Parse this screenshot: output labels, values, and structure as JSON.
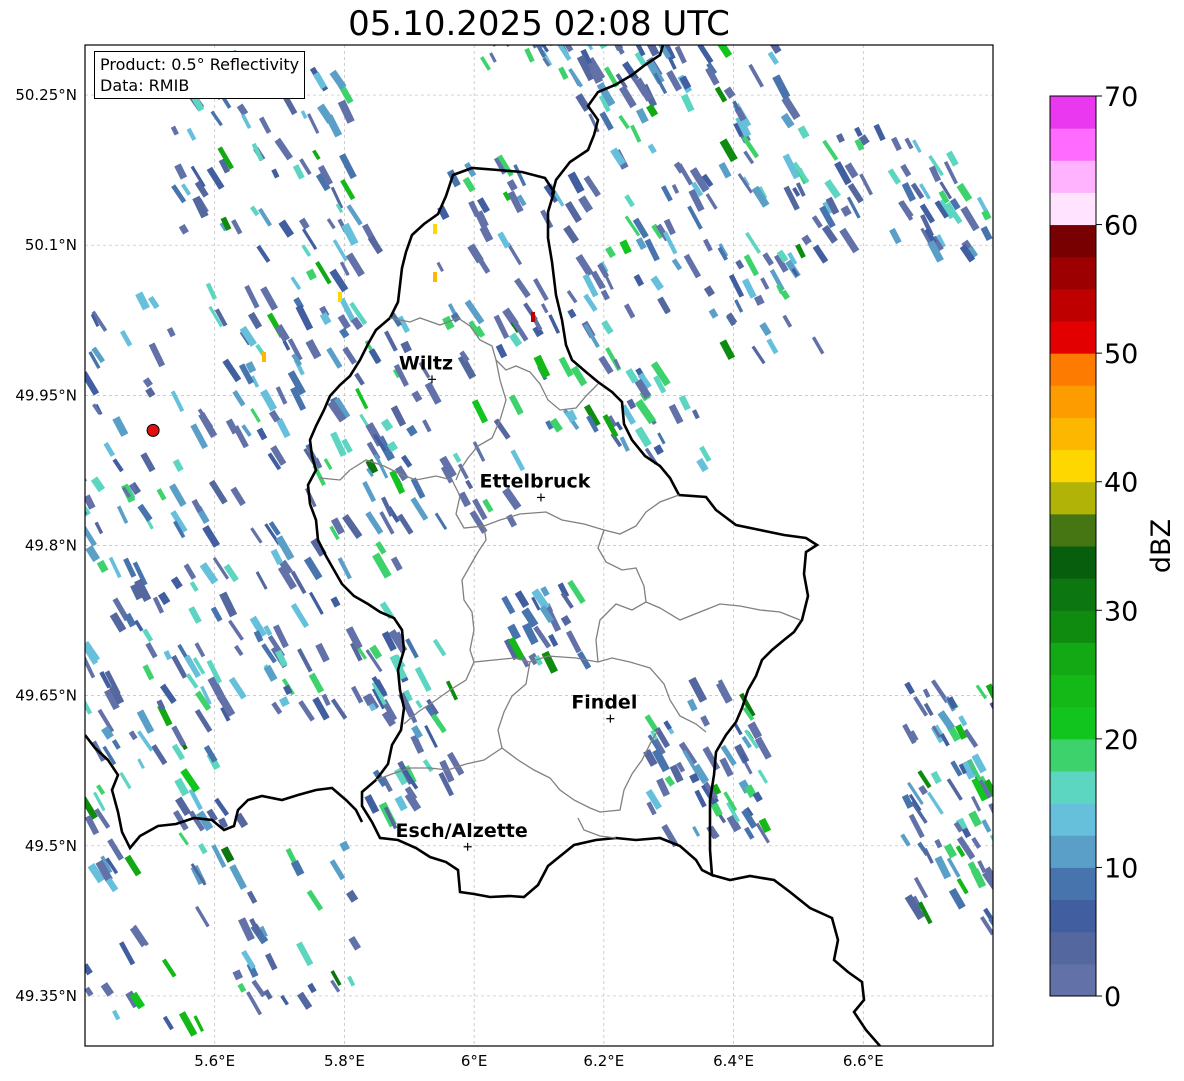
{
  "title": "05.10.2025 02:08 UTC",
  "info": {
    "product": "Product: 0.5° Reflectivity",
    "data_source": "Data: RMIB"
  },
  "map": {
    "lon_range": [
      5.4,
      6.8
    ],
    "lat_range": [
      49.3,
      50.3
    ],
    "lat_ticks": [
      {
        "value": 50.25,
        "label": "50.25°N"
      },
      {
        "value": 50.1,
        "label": "50.1°N"
      },
      {
        "value": 49.95,
        "label": "49.95°N"
      },
      {
        "value": 49.8,
        "label": "49.8°N"
      },
      {
        "value": 49.65,
        "label": "49.65°N"
      },
      {
        "value": 49.5,
        "label": "49.5°N"
      },
      {
        "value": 49.35,
        "label": "49.35°N"
      }
    ],
    "lon_ticks": [
      {
        "value": 5.6,
        "label": "5.6°E"
      },
      {
        "value": 5.8,
        "label": "5.8°E"
      },
      {
        "value": 6.0,
        "label": "6°E"
      },
      {
        "value": 6.2,
        "label": "6.2°E"
      },
      {
        "value": 6.4,
        "label": "6.4°E"
      },
      {
        "value": 6.6,
        "label": "6.6°E"
      }
    ],
    "radar_site": {
      "lon": 5.505,
      "lat": 49.915,
      "color": "#e01010"
    },
    "cities": [
      {
        "name": "Wiltz",
        "lon": 5.935,
        "lat": 49.966
      },
      {
        "name": "Ettelbruck",
        "lon": 6.103,
        "lat": 49.848
      },
      {
        "name": "Findel",
        "lon": 6.21,
        "lat": 49.627
      },
      {
        "name": "Esch/Alzette",
        "lon": 5.99,
        "lat": 49.499
      }
    ],
    "country_border_color": "#000000",
    "canton_border_color": "#808080"
  },
  "colorbar": {
    "label": "dBZ",
    "ticks": [
      "70",
      "60",
      "50",
      "40",
      "30",
      "20",
      "10",
      "0"
    ],
    "min": 0,
    "max": 70,
    "colors": [
      "#6271a8",
      "#55679f",
      "#405ea0",
      "#4874ae",
      "#5a9fc8",
      "#66c0dc",
      "#5dd6c1",
      "#3ed26d",
      "#12c51e",
      "#14b918",
      "#12a914",
      "#0f8c10",
      "#0c7610",
      "#075e0c",
      "#457613",
      "#b2b307",
      "#fed600",
      "#fdb700",
      "#fd9c00",
      "#fd7b00",
      "#e30000",
      "#bf0000",
      "#9c0000",
      "#790000",
      "#ffe3ff",
      "#ffb3ff",
      "#fe6bfe",
      "#e938f0"
    ]
  }
}
